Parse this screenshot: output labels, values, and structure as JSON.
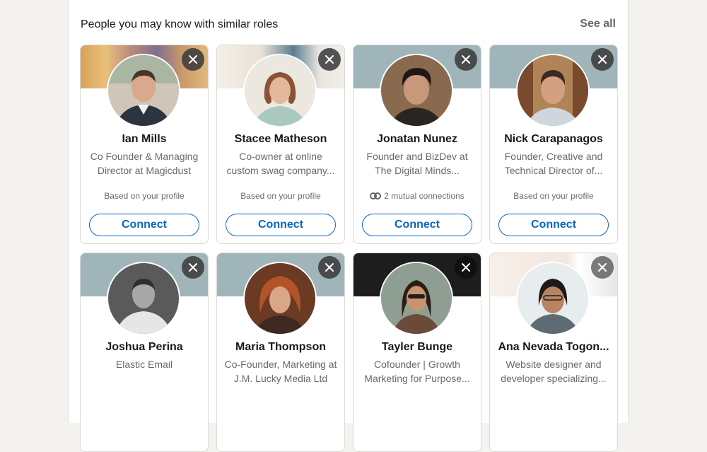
{
  "section": {
    "title": "People you may know with similar roles",
    "see_all": "See all"
  },
  "connect_label": "Connect",
  "cards": [
    {
      "name": "Ian Mills",
      "headline": "Co Founder & Managing Director at Magicdust",
      "insight": "Based on your profile"
    },
    {
      "name": "Stacee Matheson",
      "headline": "Co-owner at online custom swag company...",
      "insight": "Based on your profile"
    },
    {
      "name": "Jonatan Nunez",
      "headline": "Founder and BizDev at The Digital Minds...",
      "insight": "2 mutual connections"
    },
    {
      "name": "Nick Carapanagos",
      "headline": "Founder, Creative and Technical Director of...",
      "insight": "Based on your profile"
    },
    {
      "name": "Joshua Perina",
      "headline": "Elastic Email",
      "insight": ""
    },
    {
      "name": "Maria Thompson",
      "headline": "Co-Founder, Marketing at J.M. Lucky Media Ltd",
      "insight": ""
    },
    {
      "name": "Tayler Bunge",
      "headline": "Cofounder | Growth Marketing for Purpose...",
      "insight": ""
    },
    {
      "name": "Ana Nevada Togon...",
      "headline": "Website designer and developer specializing...",
      "insight": ""
    }
  ],
  "colors": {
    "accent": "#0a66c2",
    "page_background": "#f3f2ef"
  }
}
